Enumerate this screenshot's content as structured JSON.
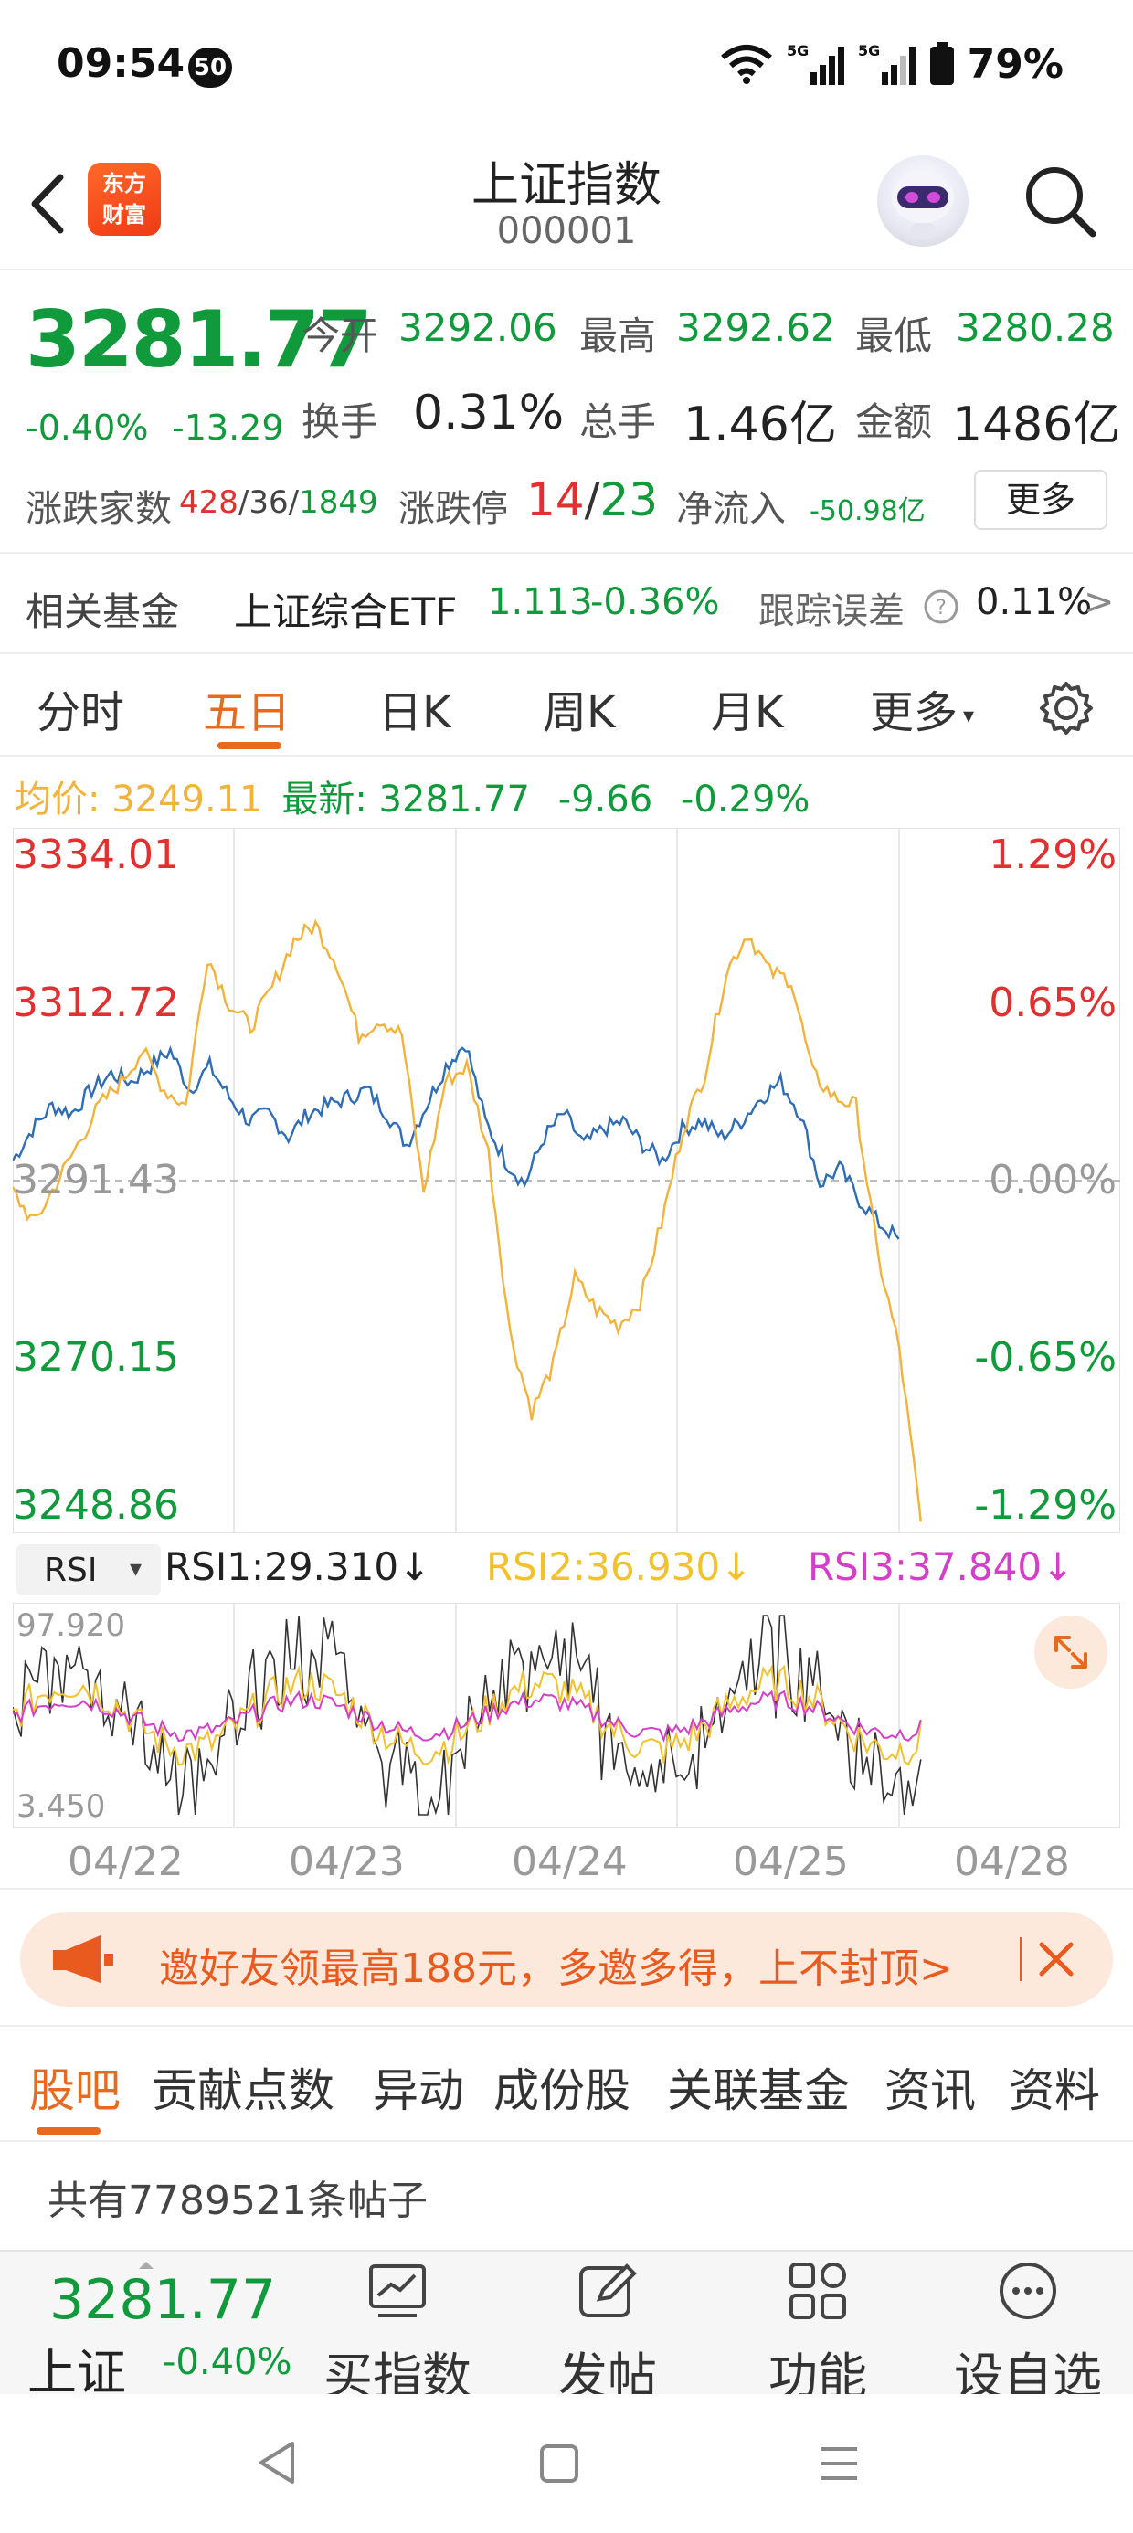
{
  "status_bar": {
    "time": "09:54",
    "badge": "50",
    "battery": "79%",
    "net1": "5G",
    "net2": "5G"
  },
  "header": {
    "title": "上证指数",
    "code": "000001",
    "logo_line1": "东方",
    "logo_line2": "财富"
  },
  "quote": {
    "price": "3281.77",
    "change_pct": "-0.40%",
    "change_val": "-13.29",
    "open_label": "今开",
    "open": "3292.06",
    "high_label": "最高",
    "high": "3292.62",
    "low_label": "最低",
    "low": "3280.28",
    "turnover_label": "换手",
    "turnover": "0.31%",
    "volume_label": "总手",
    "volume": "1.46亿",
    "amount_label": "金额",
    "amount": "1486亿",
    "breadth_label": "涨跌家数",
    "breadth_up": "428",
    "breadth_flat": "/36/",
    "breadth_down": "1849",
    "limit_label": "涨跌停",
    "limit_up": "14",
    "limit_sep": "/",
    "limit_down": "23",
    "netflow_label": "净流入",
    "netflow": "-50.98亿",
    "more_label": "更多"
  },
  "fund": {
    "label": "相关基金",
    "name": "上证综合ETF",
    "price": "1.113",
    "pct": "-0.36%",
    "error_label": "跟踪误差",
    "error": "0.11%",
    "arrow": ">"
  },
  "chart_tabs": [
    "分时",
    "五日",
    "日K",
    "周K",
    "月K",
    "更多"
  ],
  "avg": {
    "label": "均价:",
    "value": "3249.11",
    "latest_label": "最新:",
    "latest": "3281.77",
    "chg": "-9.66",
    "pct": "-0.29%"
  },
  "chart_data": [
    {
      "type": "line",
      "title": "",
      "y_left_ticks": [
        "3334.01",
        "3312.72",
        "3291.43",
        "3270.15",
        "3248.86"
      ],
      "y_right_ticks": [
        "1.29%",
        "0.65%",
        "0.00%",
        "-0.65%",
        "-1.29%"
      ],
      "ylim": [
        3248.86,
        3334.01
      ],
      "baseline": 3291.43,
      "x_labels": [
        "04/22",
        "04/23",
        "04/24",
        "04/25",
        "04/28"
      ],
      "series": [
        {
          "color": "#2f6db5",
          "values": [
            3294,
            3298,
            3301,
            3300,
            3303,
            3305,
            3304,
            3306,
            3308,
            3303,
            3306,
            3302,
            3299,
            3300,
            3297,
            3300,
            3301,
            3302,
            3303,
            3300,
            3296,
            3301,
            3306,
            3309,
            3299,
            3294,
            3291,
            3297,
            3300,
            3296,
            3298,
            3299,
            3296,
            3294,
            3298,
            3299,
            3297,
            3299,
            3302,
            3304,
            3300,
            3291,
            3293,
            3289,
            3286,
            3284
          ]
        },
        {
          "color": "#f2b33d",
          "values": [
            3290,
            3286,
            3291,
            3296,
            3301,
            3304,
            3308,
            3303,
            3301,
            3320,
            3314,
            3311,
            3316,
            3322,
            3324,
            3319,
            3310,
            3312,
            3310,
            3290,
            3304,
            3306,
            3295,
            3272,
            3262,
            3268,
            3279,
            3275,
            3273,
            3276,
            3286,
            3298,
            3305,
            3318,
            3323,
            3318,
            3317,
            3305,
            3302,
            3301,
            3282,
            3270,
            3248
          ]
        }
      ]
    },
    {
      "type": "line",
      "title": "",
      "indicator": "RSI",
      "ylim": [
        3.45,
        97.92
      ],
      "y_ticks": [
        "97.920",
        "3.450"
      ],
      "series": [
        {
          "name": "RSI1:29.310↓",
          "color": "#333333"
        },
        {
          "name": "RSI2:36.930↓",
          "color": "#f2c12e"
        },
        {
          "name": "RSI3:37.840↓",
          "color": "#d43fc8"
        }
      ]
    }
  ],
  "indicator": {
    "select": "RSI",
    "rsi1": "RSI1:29.310↓",
    "rsi2": "RSI2:36.930↓",
    "rsi3": "RSI3:37.840↓",
    "ymax": "97.920",
    "ymin": "3.450"
  },
  "promo": {
    "text": "邀好友领最高188元，多邀多得，上不封顶>"
  },
  "bottom_tabs": [
    "股吧",
    "贡献点数",
    "异动",
    "成份股",
    "关联基金",
    "资讯",
    "资料"
  ],
  "post_count": "共有7789521条帖子",
  "bottom_bar": {
    "index_price": "3281.77",
    "index_name": "上证",
    "index_pct": "-0.40%",
    "buy": "买指数",
    "post": "发帖",
    "func": "功能",
    "watch": "设自选"
  }
}
